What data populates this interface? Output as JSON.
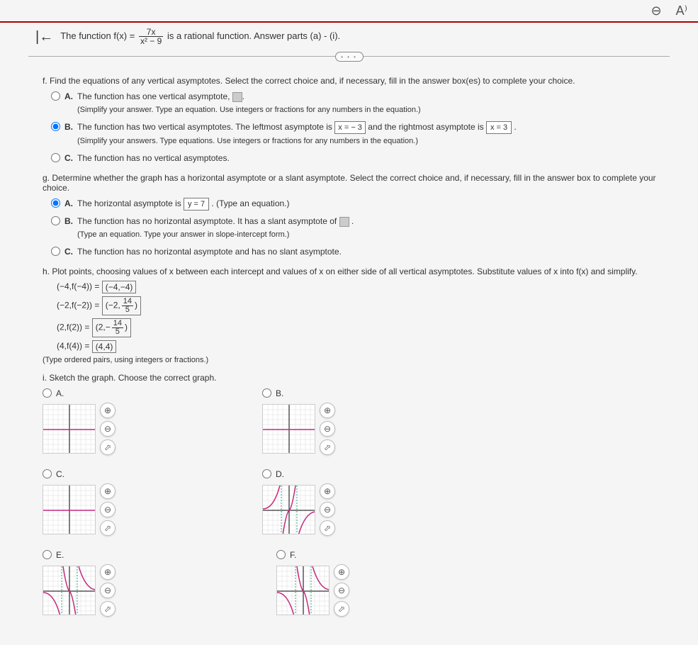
{
  "topbar": {
    "zoom_out": "⊖",
    "read_aloud": "A⁾"
  },
  "header": {
    "back": "|←",
    "prefix": "The function f(x) = ",
    "frac_num": "7x",
    "frac_den": "x² − 9",
    "suffix": " is a rational function. Answer parts (a) - (i)."
  },
  "more": "• • •",
  "part_f": {
    "prompt": "f. Find the equations of any vertical asymptotes. Select the correct choice and, if necessary, fill in the answer box(es) to complete your choice.",
    "A": {
      "letter": "A.",
      "text1": "The function has one vertical asymptote, ",
      "note": "(Simplify your answer. Type an equation. Use integers or fractions for any numbers in the equation.)"
    },
    "B": {
      "letter": "B.",
      "text1": "The function has two vertical asymptotes. The leftmost asymptote is ",
      "val1": "x = − 3",
      "text2": " and the rightmost asymptote is ",
      "val2": "x = 3",
      "text3": ".",
      "note": "(Simplify your answers. Type equations. Use integers or fractions for any numbers in the equation.)"
    },
    "C": {
      "letter": "C.",
      "text": "The function has no vertical asymptotes."
    }
  },
  "part_g": {
    "prompt": "g. Determine whether the graph has a horizontal asymptote or a slant asymptote. Select the correct choice and, if necessary, fill in the answer box to complete your choice.",
    "A": {
      "letter": "A.",
      "text1": "The horizontal asymptote is ",
      "val": "y = 7",
      "text2": ". (Type an equation.)"
    },
    "B": {
      "letter": "B.",
      "text1": "The function has no horizontal asymptote. It has a slant asymptote of ",
      "text2": ".",
      "note": "(Type an equation. Type your answer in slope-intercept form.)"
    },
    "C": {
      "letter": "C.",
      "text": "The function has no horizontal asymptote and has no slant asymptote."
    }
  },
  "part_h": {
    "prompt": "h. Plot points, choosing values of x between each intercept and values of x on either side of all vertical asymptotes. Substitute values of x into f(x) and simplify.",
    "p1": {
      "lhs": "(−4,f(−4)) = ",
      "val": "(−4,−4)"
    },
    "p2": {
      "lhs": "(−2,f(−2)) = ",
      "pair_x": "−2,",
      "frac_num": "14",
      "frac_den": "5"
    },
    "p3": {
      "lhs": "(2,f(2)) = ",
      "pair_x": "2,−",
      "frac_num": "14",
      "frac_den": "5"
    },
    "p4": {
      "lhs": "(4,f(4)) = ",
      "val": "(4,4)"
    },
    "note": "(Type ordered pairs, using integers or fractions.)"
  },
  "part_i": {
    "prompt": "i. Sketch the graph. Choose the correct graph.",
    "labels": {
      "A": "A.",
      "B": "B.",
      "C": "C.",
      "D": "D.",
      "E": "E.",
      "F": "F."
    },
    "btn": {
      "zoom_in": "⊕",
      "zoom_out": "⊖",
      "open": "⬀"
    },
    "tick": "10"
  }
}
